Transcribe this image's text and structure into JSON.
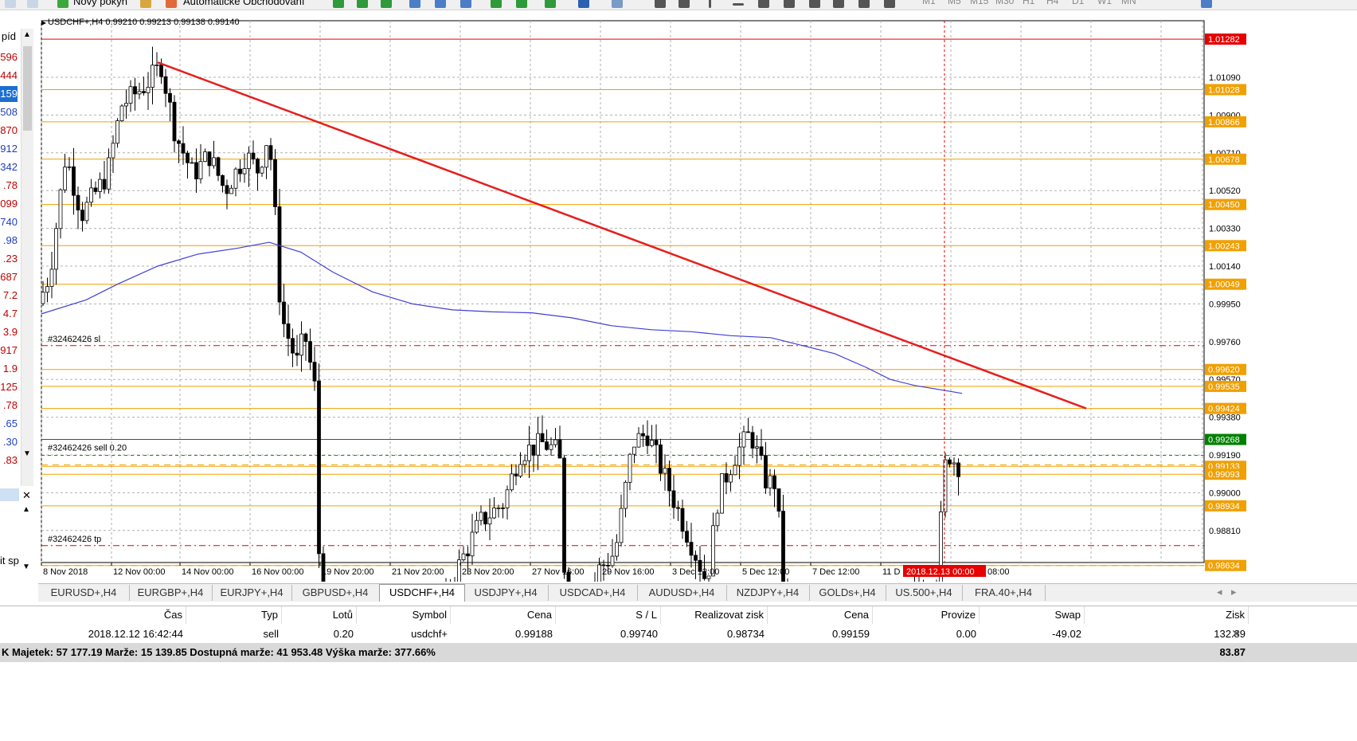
{
  "toolbar": {
    "new_order_label": "Nový pokyn",
    "auto_trading_label": "Automatické Obchodování",
    "timeframes": [
      "M1",
      "M5",
      "M15",
      "M30",
      "H1",
      "H4",
      "D1",
      "W1",
      "MN"
    ]
  },
  "market_watch": {
    "header": "píd",
    "values": [
      "596",
      "444",
      "159",
      "508",
      "870",
      "912",
      "342",
      ".78",
      "099",
      "740",
      ".98",
      ".23",
      "687",
      "7.2",
      "4.7",
      "3.9",
      "917",
      "1.9",
      "125",
      ".78",
      ".65",
      ".30",
      ".83"
    ],
    "colors": [
      "#c00000",
      "#c00000",
      "#ffffff",
      "#1f3fbf",
      "#c00000",
      "#1f3fbf",
      "#1f3fbf",
      "#c00000",
      "#c00000",
      "#1f3fbf",
      "#1f3fbf",
      "#c00000",
      "#c00000",
      "#c00000",
      "#c00000",
      "#c00000",
      "#c00000",
      "#c00000",
      "#c00000",
      "#c00000",
      "#1f3fbf",
      "#1f3fbf",
      "#c00000"
    ],
    "selected_index": 2
  },
  "lower_left": {
    "text": "it sp"
  },
  "chart": {
    "header": "USDCHF+,H4  0.99210 0.99213 0.99138 0.99140",
    "price_ticks": [
      "1.01090",
      "1.00900",
      "1.00710",
      "1.00520",
      "1.00330",
      "1.00140",
      "0.99950",
      "0.99760",
      "0.99570",
      "0.99380",
      "0.99190",
      "0.99000",
      "0.98810"
    ],
    "highlight_labels": [
      {
        "text": "1.01282",
        "price": 1.01282,
        "bg": "#e60000"
      },
      {
        "text": "1.01028",
        "price": 1.01028,
        "bg": "#f0a000"
      },
      {
        "text": "1.00866",
        "price": 1.00866,
        "bg": "#f0a000"
      },
      {
        "text": "1.00678",
        "price": 1.00678,
        "bg": "#f0a000"
      },
      {
        "text": "1.00450",
        "price": 1.0045,
        "bg": "#f0a000"
      },
      {
        "text": "1.00243",
        "price": 1.00243,
        "bg": "#f0a000"
      },
      {
        "text": "1.00049",
        "price": 1.00049,
        "bg": "#f0a000"
      },
      {
        "text": "0.99620",
        "price": 0.9962,
        "bg": "#f0a000"
      },
      {
        "text": "0.99535",
        "price": 0.99535,
        "bg": "#f0a000"
      },
      {
        "text": "0.99424",
        "price": 0.99424,
        "bg": "#f0a000"
      },
      {
        "text": "0.99268",
        "price": 0.99268,
        "bg": "#008000"
      },
      {
        "text": "0.99133",
        "price": 0.99133,
        "bg": "#f0a000"
      },
      {
        "text": "0.99093",
        "price": 0.99093,
        "bg": "#f0a000"
      },
      {
        "text": "0.98934",
        "price": 0.98934,
        "bg": "#f0a000"
      },
      {
        "text": "0.98634",
        "price": 0.98634,
        "bg": "#f0a000"
      }
    ],
    "trade_labels": {
      "sl": "#32462426 sl",
      "sell": "#32462426 sell 0.20",
      "tp": "#32462426 tp"
    },
    "time_ticks": [
      "8 Nov 2018",
      "12 Nov 00:00",
      "14 Nov 00:00",
      "16 Nov 00:00",
      "19 Nov 20:00",
      "21 Nov 20:00",
      "23 Nov 20:00",
      "27 Nov 16:00",
      "29 Nov 16:00",
      "3 Dec 12:00",
      "5 Dec 12:00",
      "7 Dec 12:00",
      "11 D"
    ],
    "cursor_time": "2018.12.13 00:00",
    "after_cursor_time": "08:00"
  },
  "tabs": [
    "EURUSD+,H4",
    "EURGBP+,H4",
    "EURJPY+,H4",
    "GBPUSD+,H4",
    "USDCHF+,H4",
    "USDJPY+,H4",
    "USDCAD+,H4",
    "AUDUSD+,H4",
    "NZDJPY+,H4",
    "GOLDs+,H4",
    "US.500+,H4",
    "FRA.40+,H4"
  ],
  "active_tab": 4,
  "terminal": {
    "headers": [
      "Čas",
      "Typ",
      "Lotů",
      "Symbol",
      "Cena",
      "S / L",
      "Realizovat zisk",
      "Cena",
      "Provize",
      "Swap",
      "Zisk"
    ],
    "row": [
      "2018.12.12 16:42:44",
      "sell",
      "0.20",
      "usdchf+",
      "0.99188",
      "0.99740",
      "0.98734",
      "0.99159",
      "0.00",
      "-49.02",
      "132.89"
    ],
    "summary": "K  Majetek: 57 177.19  Marže: 15 139.85  Dostupná marže: 41 953.48  Výška marže: 377.66%",
    "summary_profit": "83.87"
  }
}
